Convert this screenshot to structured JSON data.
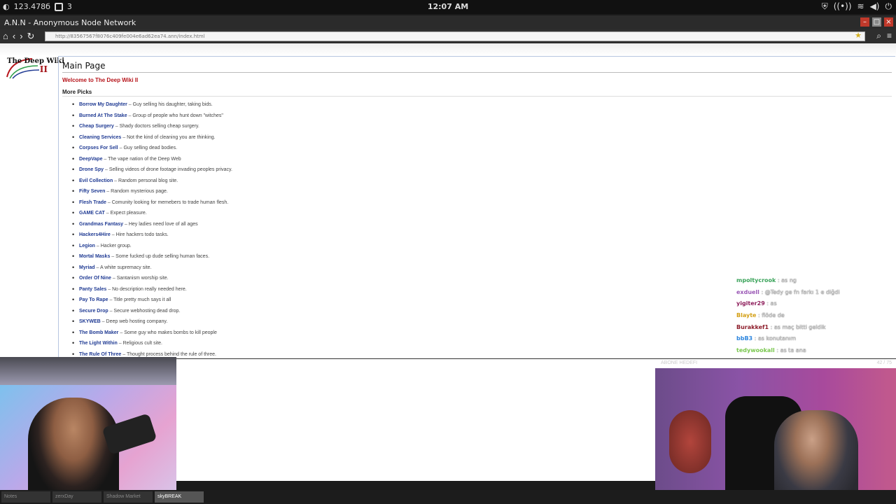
{
  "os": {
    "left_count": "123.478б",
    "left_num": "3",
    "clock": "12:07 AM"
  },
  "window": {
    "title": "A.N.N - Anonymous Node Network"
  },
  "address": {
    "url": "http://83567567f8076c409fe004e6ad62ea74.ann/index.html"
  },
  "site": {
    "logo_line1": "The Deep Wiki",
    "logo_line2": "II",
    "page_title": "Main Page",
    "welcome": "Welcome to The Deep Wiki II",
    "section": "More Picks",
    "picks": [
      {
        "name": "Borrow My Daughter",
        "desc": "Guy selling his daughter, taking bids."
      },
      {
        "name": "Burned At The Stake",
        "desc": "Group of people who hunt down \"witches\""
      },
      {
        "name": "Cheap Surgery",
        "desc": "Shady doctors selling cheap surgery."
      },
      {
        "name": "Cleaning Services",
        "desc": "Not the kind of cleaning you are thinking."
      },
      {
        "name": "Corpses For Sell",
        "desc": "Guy selling dead bodies."
      },
      {
        "name": "DeepVape",
        "desc": "The vape nation of the Deep Web"
      },
      {
        "name": "Drone Spy",
        "desc": "Selling videos of drone footage invading peoples privacy."
      },
      {
        "name": "Evil Collection",
        "desc": "Random personal blog site."
      },
      {
        "name": "Fifty Seven",
        "desc": "Random mysterious page."
      },
      {
        "name": "Flesh Trade",
        "desc": "Comunity looking for memebers to trade human flesh."
      },
      {
        "name": "GAME CAT",
        "desc": "Expect pleasure."
      },
      {
        "name": "Grandmas Fantasy",
        "desc": "Hey ladies need love of all ages"
      },
      {
        "name": "Hackers4Hire",
        "desc": "Hire hackers todo tasks."
      },
      {
        "name": "Legion",
        "desc": "Hacker group."
      },
      {
        "name": "Mortal Masks",
        "desc": "Some fucked up dude selling human faces."
      },
      {
        "name": "Myriad",
        "desc": "A white supremacy site."
      },
      {
        "name": "Order Of Nine",
        "desc": "Santanism worship site."
      },
      {
        "name": "Panty Sales",
        "desc": "No description really needed here."
      },
      {
        "name": "Pay To Rape",
        "desc": "Title pretty much says it all"
      },
      {
        "name": "Secure Drop",
        "desc": "Secure webhosting dead drop."
      },
      {
        "name": "SKYWEB",
        "desc": "Deep web hosting company."
      },
      {
        "name": "The Bomb Maker",
        "desc": "Some guy who makes bombs to kill people"
      },
      {
        "name": "The Light Within",
        "desc": "Religious cult site."
      },
      {
        "name": "The Rule Of Three",
        "desc": "Thought process behind the rule of three."
      }
    ]
  },
  "chat": {
    "messages": [
      {
        "user": "mpoltycrook",
        "text": "as ng",
        "color": "#3aa35a"
      },
      {
        "user": "exduell",
        "text": "@Tedy ge fn farkı 1 e diğdi",
        "color": "#9b59b6"
      },
      {
        "user": "yigiter29",
        "text": "as",
        "color": "#8e1f5c"
      },
      {
        "user": "Blayte",
        "text": "flöde de",
        "color": "#d4a017"
      },
      {
        "user": "Burakkef1",
        "text": "as maç bitti geldik",
        "color": "#8e1f2c"
      },
      {
        "user": "bbB3",
        "text": "as konutanım",
        "color": "#2e86de"
      },
      {
        "user": "tedywookall",
        "text": "as ta ana",
        "color": "#7ac74f"
      }
    ],
    "footer_left": "ABONE HEDEFI",
    "footer_right": "42 / 75"
  },
  "taskbar": [
    {
      "label": "Notes",
      "active": false
    },
    {
      "label": "zerxDay",
      "active": false
    },
    {
      "label": "Shadow Market",
      "active": false
    },
    {
      "label": "skyBREAK",
      "active": true
    }
  ]
}
